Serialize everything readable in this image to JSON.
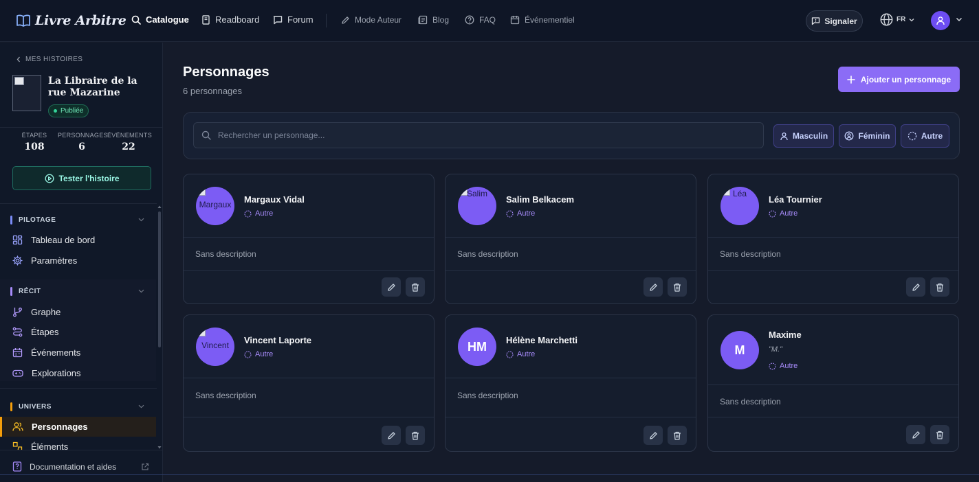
{
  "app": {
    "name": "Livre Arbitre"
  },
  "nav": {
    "items": [
      {
        "label": "Catalogue",
        "icon": "search-icon"
      },
      {
        "label": "Readboard",
        "icon": "book-icon"
      },
      {
        "label": "Forum",
        "icon": "chat-icon"
      },
      {
        "label": "Mode Auteur",
        "icon": "pen-icon"
      },
      {
        "label": "Blog",
        "icon": "newspaper-icon"
      },
      {
        "label": "FAQ",
        "icon": "help-icon"
      },
      {
        "label": "Événementiel",
        "icon": "calendar-icon"
      }
    ],
    "report_label": "Signaler",
    "language": "FR"
  },
  "sidebar": {
    "back_label": "MES HISTOIRES",
    "story_title": "La Libraire de la rue Mazarine",
    "status_badge": "Publiée",
    "stats": [
      {
        "label": "ÉTAPES",
        "value": "108"
      },
      {
        "label": "PERSONNAGES",
        "value": "6"
      },
      {
        "label": "ÉVÉNEMENTS",
        "value": "22"
      }
    ],
    "test_button": "Tester l'histoire",
    "sections": [
      {
        "title": "PILOTAGE",
        "color": "#7b8cf7",
        "items": [
          {
            "label": "Tableau de bord"
          },
          {
            "label": "Paramètres"
          }
        ]
      },
      {
        "title": "RÉCIT",
        "color": "#a78bfa",
        "items": [
          {
            "label": "Graphe"
          },
          {
            "label": "Étapes"
          },
          {
            "label": "Événements"
          },
          {
            "label": "Explorations"
          }
        ]
      },
      {
        "title": "UNIVERS",
        "color": "#f59e0b",
        "items": [
          {
            "label": "Personnages"
          },
          {
            "label": "Éléments"
          }
        ]
      }
    ],
    "doc_link": "Documentation et aides"
  },
  "main": {
    "title": "Personnages",
    "count_label": "6 personnages",
    "add_button": "Ajouter un personnage",
    "search_placeholder": "Rechercher un personnage...",
    "filters": [
      "Masculin",
      "Féminin",
      "Autre"
    ],
    "characters": [
      {
        "name": "Margaux Vidal",
        "gender": "Autre",
        "avatar_alt": "Margaux",
        "description": "Sans description"
      },
      {
        "name": "Salim Belkacem",
        "gender": "Autre",
        "avatar_alt": "Salim",
        "description": "Sans description"
      },
      {
        "name": "Léa Tournier",
        "gender": "Autre",
        "avatar_alt": "Léa",
        "description": "Sans description"
      },
      {
        "name": "Vincent Laporte",
        "gender": "Autre",
        "avatar_alt": "Vincent",
        "description": "Sans description"
      },
      {
        "name": "Hélène Marchetti",
        "gender": "Autre",
        "initials": "HM",
        "description": "Sans description"
      },
      {
        "name": "Maxime",
        "nickname": "\"M.\"",
        "gender": "Autre",
        "initials": "M",
        "description": "Sans description"
      }
    ]
  },
  "colors": {
    "accent": "#8b6cf6",
    "avatar": "#7c5cf4",
    "published": "#34d399",
    "univers": "#f59e0b"
  }
}
